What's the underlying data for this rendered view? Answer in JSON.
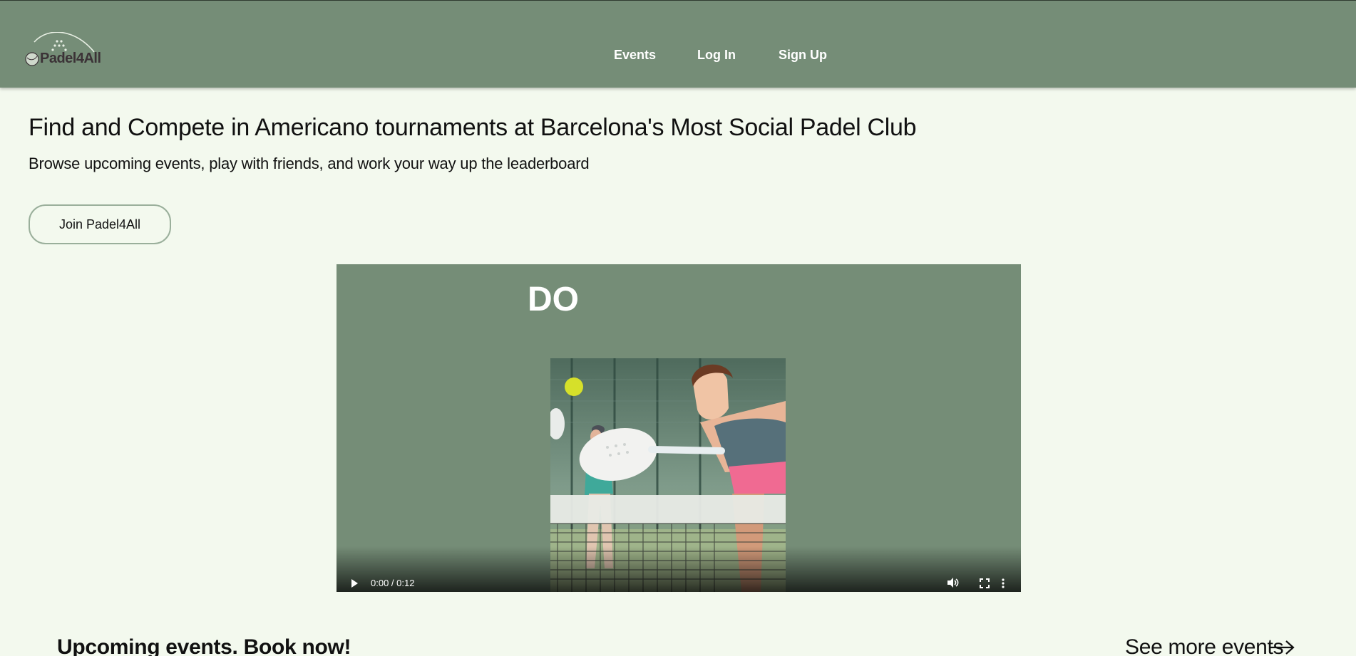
{
  "header": {
    "logo_text": "Padel4All",
    "nav": [
      {
        "label": "Events"
      },
      {
        "label": "Log In"
      },
      {
        "label": "Sign Up"
      }
    ]
  },
  "hero": {
    "title": "Find and Compete in Americano tournaments at Barcelona's Most Social Padel Club",
    "subtitle": "Browse upcoming events, play with friends, and work your way up the leaderboard",
    "join_label": "Join Padel4All"
  },
  "video": {
    "caption": "DO",
    "time": "0:00 / 0:12",
    "progress": 0,
    "controls": {
      "play_icon": "play-icon",
      "volume_icon": "volume-icon",
      "fullscreen_icon": "fullscreen-icon",
      "more_icon": "more-options-icon"
    }
  },
  "events": {
    "title": "Upcoming events. Book now!",
    "see_more_label": "See more events"
  },
  "colors": {
    "header_bg": "#758d77",
    "page_bg": "#f3f9ee",
    "video_bg": "#758d77",
    "button_border": "#9aaf9b"
  }
}
